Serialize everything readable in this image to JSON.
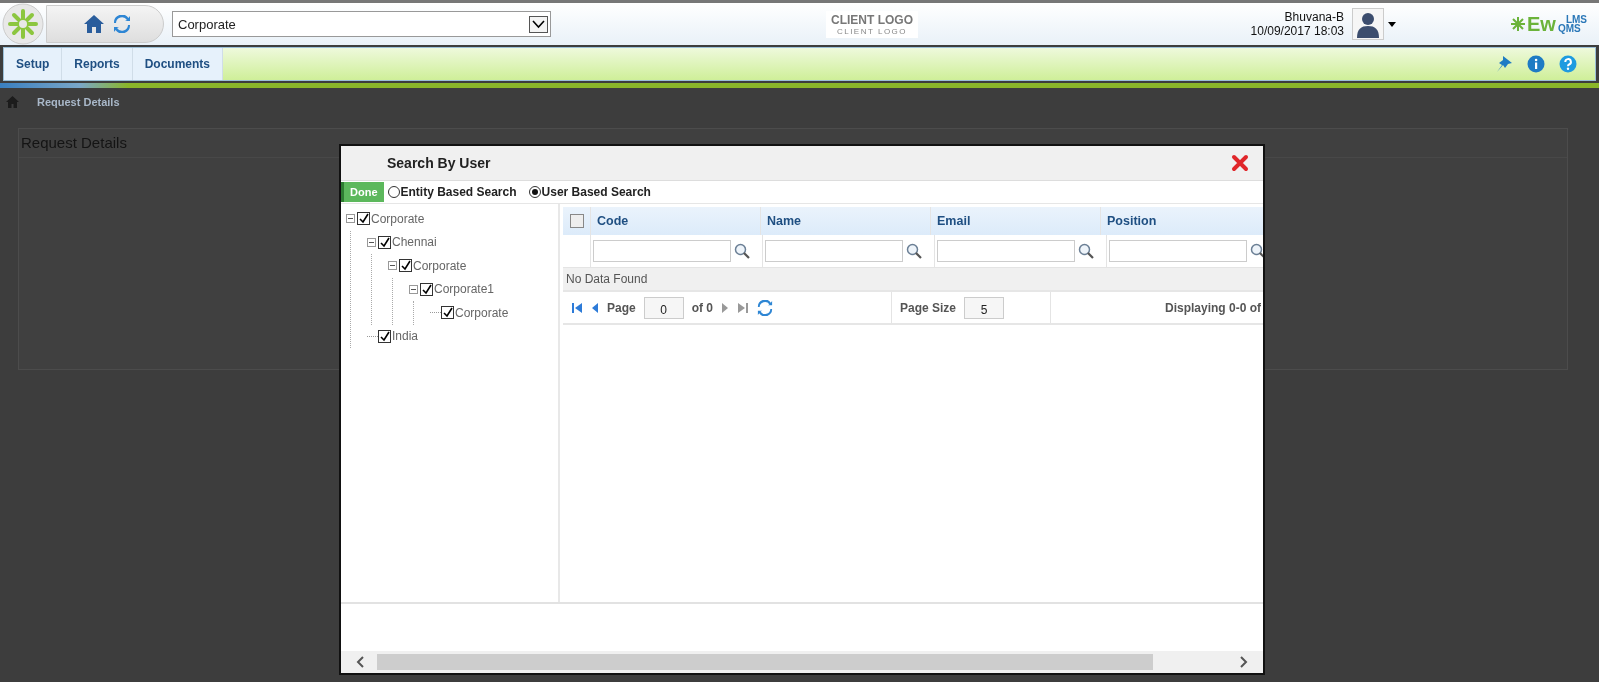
{
  "header": {
    "location_select": "Corporate",
    "client_logo": "CLIENT LOGO",
    "client_logo_tagline": "CLIENT LOGO",
    "user_name": "Bhuvana-B",
    "datetime": "10/09/2017 18:03",
    "brand": "Ew",
    "brand_sub": "QMS",
    "brand_sup": "LMS"
  },
  "menu": [
    {
      "label": "Setup"
    },
    {
      "label": "Reports"
    },
    {
      "label": "Documents"
    }
  ],
  "breadcrumb": "Request Details",
  "panel": {
    "title": "Request Details"
  },
  "modal": {
    "title": "Search By User",
    "done_button": "Done",
    "search_modes": [
      {
        "label": "Entity Based Search",
        "selected": false
      },
      {
        "label": "User Based Search",
        "selected": true
      }
    ],
    "tree": [
      {
        "label": "Corporate",
        "checked": true,
        "expanded": true,
        "children": [
          {
            "label": "Chennai",
            "checked": true,
            "expanded": true,
            "children": [
              {
                "label": "Corporate",
                "checked": true,
                "expanded": true,
                "children": [
                  {
                    "label": "Corporate1",
                    "checked": true,
                    "expanded": true,
                    "children": [
                      {
                        "label": "Corporate",
                        "checked": true
                      }
                    ]
                  }
                ]
              }
            ]
          },
          {
            "label": "India",
            "checked": true
          }
        ]
      }
    ],
    "grid": {
      "select_all_checked": false,
      "columns": [
        "Code",
        "Name",
        "Email",
        "Position"
      ],
      "empty_message": "No Data Found",
      "pager": {
        "page_label": "Page",
        "page": "0",
        "of_total": "of 0",
        "page_size_label": "Page Size",
        "page_size": "5",
        "summary": "Displaying 0-0 of"
      }
    }
  }
}
